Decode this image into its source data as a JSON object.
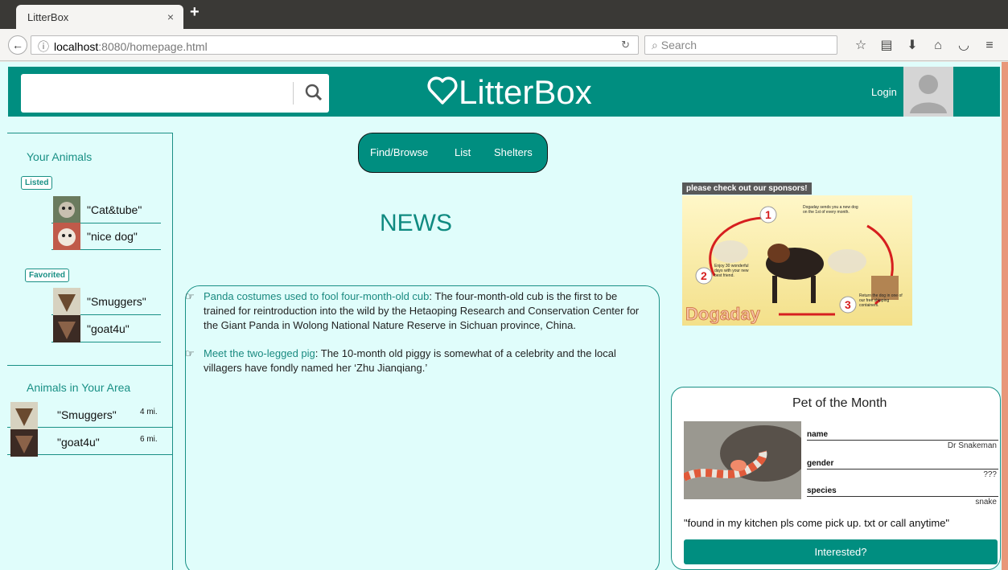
{
  "browser": {
    "tab_title": "LitterBox",
    "tab_close": "×",
    "new_tab": "+",
    "url_host": "localhost",
    "url_rest": ":8080/homepage.html",
    "search_placeholder": "Search"
  },
  "header": {
    "brand": "LitterBox",
    "login": "Login"
  },
  "nav": {
    "items": [
      "Find/Browse",
      "List",
      "Shelters"
    ]
  },
  "sidebar": {
    "your_animals_title": "Your Animals",
    "listed_badge": "Listed",
    "listed": [
      {
        "name": "\"Cat&tube\""
      },
      {
        "name": "\"nice dog\""
      }
    ],
    "favorited_badge": "Favorited",
    "favorited": [
      {
        "name": "\"Smuggers\""
      },
      {
        "name": "\"goat4u\""
      }
    ],
    "area_title": "Animals in Your Area",
    "area": [
      {
        "name": "\"Smuggers\"",
        "distance": "4 mi."
      },
      {
        "name": "\"goat4u\"",
        "distance": "6 mi."
      }
    ]
  },
  "news": {
    "title": "NEWS",
    "items": [
      {
        "link": "Panda costumes used to fool four-month-old cub",
        "text": ": The four-month-old cub is the first to be trained for reintroduction into the wild by the Hetaoping Research and Conservation Center for the Giant Panda in Wolong National Nature Reserve in Sichuan province, China."
      },
      {
        "link": "Meet the two-legged pig",
        "text": ": The 10-month old piggy is somewhat of a celebrity and the local villagers have fondly named her ‘Zhu Jianqiang.’"
      }
    ]
  },
  "sponsors": {
    "label": "please check out our sponsors!",
    "ad_brand": "Dogaday",
    "ad_step1": "Dogaday sends you a new dog on the 1st of every month.",
    "ad_step2": "Enjoy 30 wonderful days with your new best friend.",
    "ad_step3": "Return the dog in one of our free shipping containers."
  },
  "pet_of_month": {
    "title": "Pet of the Month",
    "fields": [
      {
        "label": "name",
        "value": "Dr Snakeman"
      },
      {
        "label": "gender",
        "value": "???"
      },
      {
        "label": "species",
        "value": "snake"
      }
    ],
    "description": "\"found in my kitchen pls come pick up. txt or call anytime\"",
    "button": "Interested?"
  },
  "colors": {
    "primary": "#008e80",
    "background": "#e0fdfb",
    "accent_line": "#199085"
  }
}
